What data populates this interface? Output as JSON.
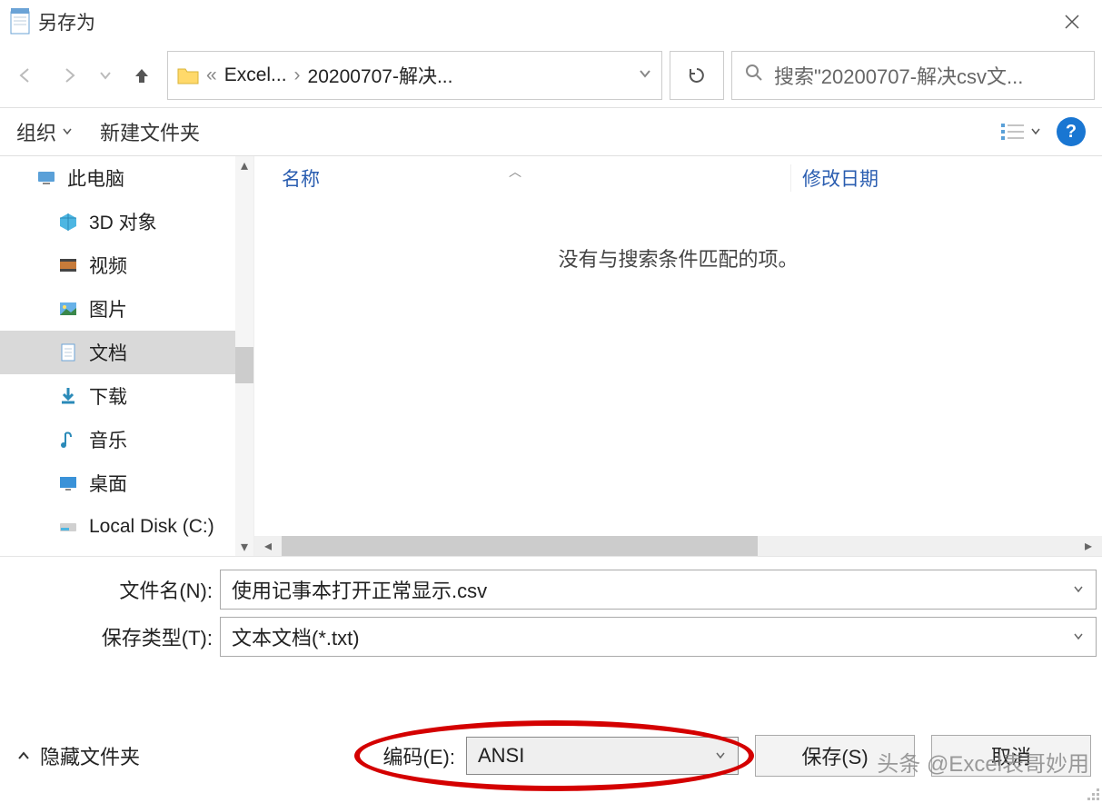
{
  "title": "另存为",
  "breadcrumb": {
    "seg1": "Excel...",
    "seg2": "20200707-解决..."
  },
  "search_placeholder": "搜索\"20200707-解决csv文...",
  "toolbar": {
    "organize": "组织",
    "newfolder": "新建文件夹"
  },
  "tree": {
    "root": "此电脑",
    "items": [
      "3D 对象",
      "视频",
      "图片",
      "文档",
      "下载",
      "音乐",
      "桌面",
      "Local Disk (C:)"
    ],
    "selected_index": 3
  },
  "columns": {
    "name": "名称",
    "modified": "修改日期"
  },
  "empty_message": "没有与搜索条件匹配的项。",
  "form": {
    "filename_label": "文件名(N):",
    "filename_value": "使用记事本打开正常显示.csv",
    "savetype_label": "保存类型(T):",
    "savetype_value": "文本文档(*.txt)"
  },
  "footer": {
    "hide_folders": "隐藏文件夹",
    "encoding_label": "编码(E):",
    "encoding_value": "ANSI",
    "save": "保存(S)",
    "cancel": "取消"
  },
  "watermark": "头条 @Excel表哥妙用"
}
